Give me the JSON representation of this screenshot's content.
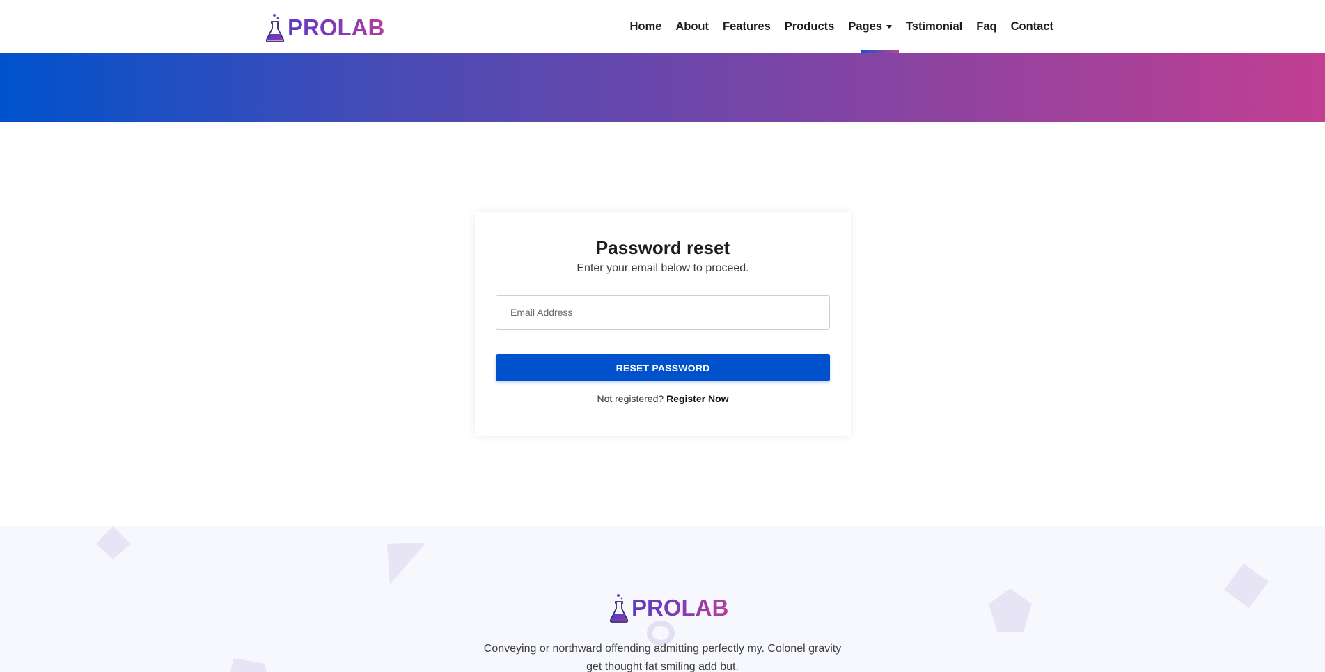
{
  "brand": {
    "name": "PROLAB",
    "gradient_colors": [
      "#5b3bc4",
      "#b43f9e"
    ]
  },
  "nav": {
    "items": [
      {
        "label": "Home"
      },
      {
        "label": "About"
      },
      {
        "label": "Features"
      },
      {
        "label": "Products"
      },
      {
        "label": "Pages",
        "has_dropdown": true
      },
      {
        "label": "Tstimonial"
      },
      {
        "label": "Faq"
      },
      {
        "label": "Contact"
      }
    ],
    "active": "Pages"
  },
  "banner": {
    "gradient_start": "#0052cc",
    "gradient_end": "#c13f92"
  },
  "reset_form": {
    "title": "Password reset",
    "subtitle": "Enter your email below to proceed.",
    "email_placeholder": "Email Address",
    "email_value": "",
    "button_label": "RESET PASSWORD",
    "button_color": "#0052cc",
    "register_prompt": "Not registered?",
    "register_link": "Register Now"
  },
  "footer": {
    "brand": "PROLAB",
    "description_line1": "Conveying or northward offending admitting perfectly my. Colonel gravity",
    "description_line2": "get thought fat smiling add but."
  }
}
